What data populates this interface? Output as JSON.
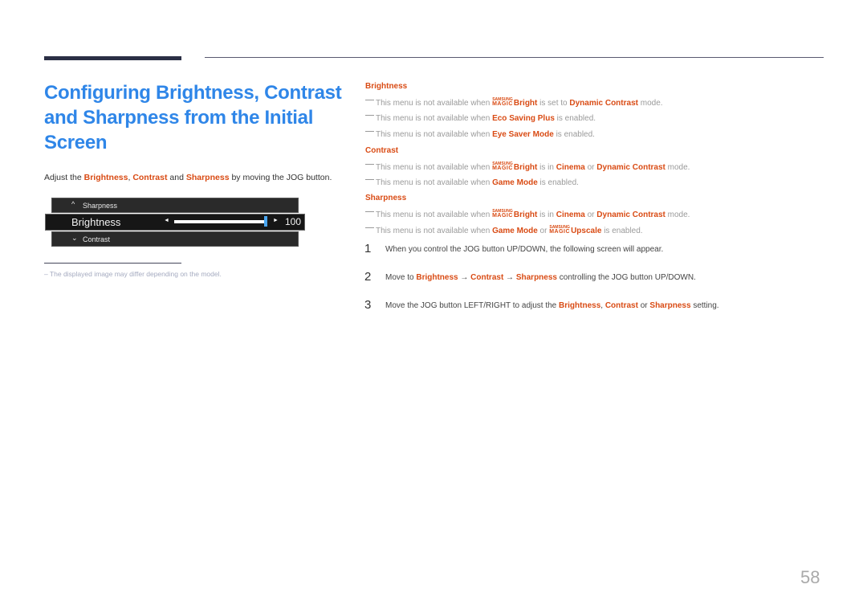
{
  "header": {
    "title": "Configuring Brightness, Contrast and Sharpness from the Initial Screen"
  },
  "intro": {
    "prefix": "Adjust the ",
    "brightness": "Brightness",
    "comma": ", ",
    "contrast": "Contrast",
    "and": " and ",
    "sharpness": "Sharpness",
    "suffix": " by moving the JOG button."
  },
  "osd": {
    "prev_item": "Sharpness",
    "current_item": "Brightness",
    "next_item": "Contrast",
    "value": "100",
    "slider_fraction": 1.0,
    "up_chevron": "^",
    "down_chevron": "⌄",
    "left_arrow": "◄",
    "right_arrow": "►"
  },
  "footnote": "–  The displayed image may differ depending on the model.",
  "sections": {
    "brightness": {
      "heading": "Brightness",
      "notes": [
        {
          "pre": "This menu is not available when ",
          "magic_label": "Bright",
          "mid": " is set to ",
          "hl": "Dynamic Contrast",
          "post": " mode."
        },
        {
          "pre": "This menu is not available when ",
          "hl": "Eco Saving Plus",
          "post": " is enabled."
        },
        {
          "pre": "This menu is not available when ",
          "hl": "Eye Saver Mode",
          "post": " is enabled."
        }
      ]
    },
    "contrast": {
      "heading": "Contrast",
      "notes": [
        {
          "pre": "This menu is not available when ",
          "magic_label": "Bright",
          "mid": " is in ",
          "hl1": "Cinema",
          "or": " or ",
          "hl2": "Dynamic Contrast",
          "post": " mode."
        },
        {
          "pre": "This menu is not available when ",
          "hl": "Game Mode",
          "post": " is enabled."
        }
      ]
    },
    "sharpness": {
      "heading": "Sharpness",
      "notes": [
        {
          "pre": "This menu is not available when ",
          "magic_label": "Bright",
          "mid": " is in ",
          "hl1": "Cinema",
          "or": " or ",
          "hl2": "Dynamic Contrast",
          "post": " mode."
        },
        {
          "pre": "This menu is not available when ",
          "hl": "Game Mode",
          "or": " or ",
          "magic_label": "Upscale",
          "post": " is enabled."
        }
      ]
    }
  },
  "magic_brand": {
    "top": "SAMSUNG",
    "bottom": "MAGIC"
  },
  "steps": [
    {
      "num": "1",
      "text": "When you control the JOG button UP/DOWN, the following screen will appear."
    },
    {
      "num": "2",
      "pre": "Move to ",
      "hl1": "Brightness",
      "arrow1": " → ",
      "hl2": "Contrast",
      "arrow2": " → ",
      "hl3": "Sharpness",
      "post": " controlling the JOG button UP/DOWN."
    },
    {
      "num": "3",
      "pre": "Move the JOG button LEFT/RIGHT to adjust the ",
      "hl1": "Brightness",
      "c": ", ",
      "hl2": "Contrast",
      "or": " or ",
      "hl3": "Sharpness",
      "post": " setting."
    }
  ],
  "page_number": "58",
  "colors": {
    "title_blue": "#2f86e8",
    "highlight_orange": "#d94b14",
    "slider_thumb": "#4aa6f0"
  }
}
